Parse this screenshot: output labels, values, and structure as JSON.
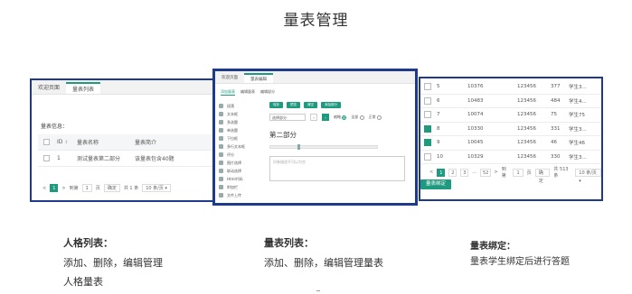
{
  "page": {
    "title": "量表管理"
  },
  "left_panel": {
    "tabs": [
      "欢迎页面",
      "量表列表"
    ],
    "section_label": "量表信息：",
    "table": {
      "headers": [
        "ID",
        "量表名称",
        "量表简介"
      ],
      "rows": [
        [
          "1",
          "测试量表第二部分",
          "该量表包含40题"
        ]
      ]
    },
    "pager": {
      "prev": "<",
      "page": "1",
      "next": ">",
      "goto_label": "到第",
      "goto_value": "1",
      "page_unit": "页",
      "confirm": "确定",
      "total": "共 1 条",
      "per_page": "10 条/页"
    }
  },
  "middle_panel": {
    "tabs": [
      "欢迎页面",
      "量表编辑"
    ],
    "subtabs": [
      "添加量表",
      "编辑量表",
      "编辑部分"
    ],
    "sidebar": [
      "段落",
      "文本框",
      "多选题",
      "单选题",
      "下拉框",
      "多行文本框",
      "评分",
      "图片选择",
      "联动选择",
      "Html代码",
      "附加栏",
      "文件上传"
    ],
    "buttons": [
      "保存",
      "预览",
      "清空",
      "添加部分"
    ],
    "select_placeholder": "选择部分",
    "toolbar_options": [
      "缩略",
      "全部",
      "正常"
    ],
    "section_title": "第二部分",
    "textarea_placeholder": "问卷描述不可以为空"
  },
  "right_panel": {
    "rows": [
      {
        "checked": false,
        "n": "5",
        "id": "10376",
        "pwd": "123456",
        "score": "377",
        "name": "学生3..."
      },
      {
        "checked": false,
        "n": "6",
        "id": "10483",
        "pwd": "123456",
        "score": "484",
        "name": "学生4..."
      },
      {
        "checked": false,
        "n": "7",
        "id": "10074",
        "pwd": "123456",
        "score": "75",
        "name": "学生75"
      },
      {
        "checked": true,
        "n": "8",
        "id": "10330",
        "pwd": "123456",
        "score": "331",
        "name": "学生3..."
      },
      {
        "checked": true,
        "n": "9",
        "id": "10045",
        "pwd": "123456",
        "score": "46",
        "name": "学生46"
      },
      {
        "checked": false,
        "n": "10",
        "id": "10329",
        "pwd": "123456",
        "score": "330",
        "name": "学生3..."
      }
    ],
    "pager": {
      "prev": "<",
      "pages": [
        "1",
        "2",
        "3",
        "...",
        "52"
      ],
      "next": ">",
      "goto_label": "到第",
      "goto_value": "1",
      "page_unit": "页",
      "confirm": "确定",
      "total": "共 513 条",
      "per_page": "10 条/页"
    },
    "bind_button": "量表绑定"
  },
  "captions": {
    "left_title": "人格列表：",
    "left_text_1": "添加、删除，编辑管理",
    "left_text_2": "人格量表",
    "mid_title": "量表列表：",
    "mid_text": "添加、删除，编辑管理量表",
    "right_title": "量表绑定：",
    "right_text": "量表学生绑定后进行答题"
  },
  "colors": {
    "accent": "#1e9a7e",
    "frame": "#1f3a8a"
  }
}
